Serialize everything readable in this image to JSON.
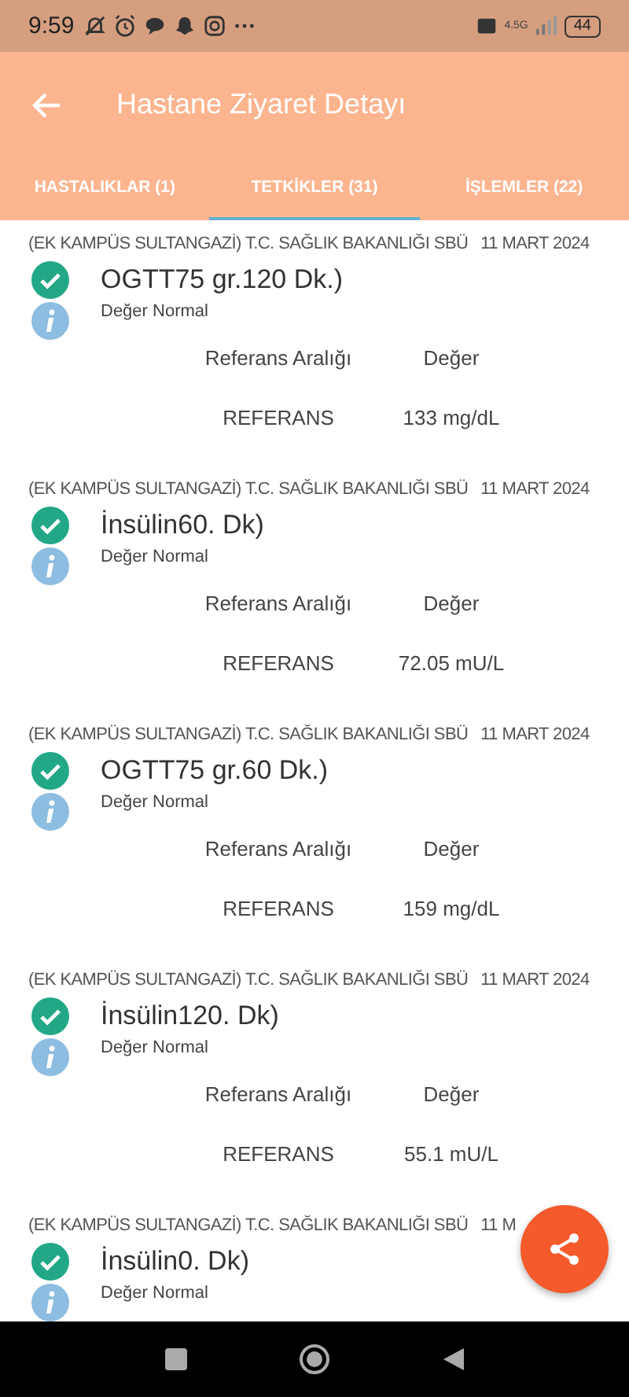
{
  "status_bar": {
    "time": "9:59",
    "network": "4.5G",
    "battery": "44"
  },
  "app_bar": {
    "title": "Hastane Ziyaret Detayı"
  },
  "tabs": [
    {
      "label": "HASTALIKLAR (1)",
      "selected": false
    },
    {
      "label": "TETKİKLER (31)",
      "selected": true
    },
    {
      "label": "İŞLEMLER (22)",
      "selected": false
    }
  ],
  "tests": [
    {
      "hospital": "(EK KAMPÜS SULTANGAZİ) T.C. SAĞLIK BAKANLIĞI SBÜ",
      "date": "11 MART 2024",
      "name": "OGTT75 gr.120 Dk.)",
      "status": "Değer Normal",
      "reference_label": "Referans Aralığı",
      "value_label": "Değer",
      "reference": "REFERANS",
      "value": "133 mg/dL"
    },
    {
      "hospital": "(EK KAMPÜS SULTANGAZİ) T.C. SAĞLIK BAKANLIĞI SBÜ",
      "date": "11 MART 2024",
      "name": "İnsülin60. Dk)",
      "status": "Değer Normal",
      "reference_label": "Referans Aralığı",
      "value_label": "Değer",
      "reference": "REFERANS",
      "value": "72.05 mU/L"
    },
    {
      "hospital": "(EK KAMPÜS SULTANGAZİ) T.C. SAĞLIK BAKANLIĞI SBÜ",
      "date": "11 MART 2024",
      "name": "OGTT75 gr.60 Dk.)",
      "status": "Değer Normal",
      "reference_label": "Referans Aralığı",
      "value_label": "Değer",
      "reference": "REFERANS",
      "value": "159 mg/dL"
    },
    {
      "hospital": "(EK KAMPÜS SULTANGAZİ) T.C. SAĞLIK BAKANLIĞI SBÜ",
      "date": "11 MART 2024",
      "name": "İnsülin120. Dk)",
      "status": "Değer Normal",
      "reference_label": "Referans Aralığı",
      "value_label": "Değer",
      "reference": "REFERANS",
      "value": "55.1 mU/L"
    },
    {
      "hospital": "(EK KAMPÜS SULTANGAZİ) T.C. SAĞLIK BAKANLIĞI SBÜ",
      "date": "11 M",
      "name": "İnsülin0. Dk)",
      "status": "Değer Normal"
    }
  ]
}
